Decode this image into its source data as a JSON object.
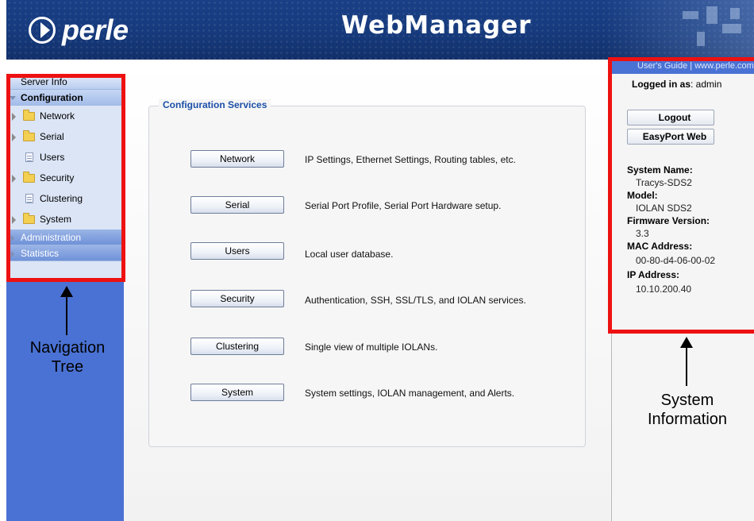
{
  "header": {
    "logo_text": "perle",
    "title": "WebManager"
  },
  "nav": {
    "server_info": "Server Info",
    "configuration": "Configuration",
    "items": [
      {
        "label": "Network",
        "kind": "folder"
      },
      {
        "label": "Serial",
        "kind": "folder"
      },
      {
        "label": "Users",
        "kind": "doc"
      },
      {
        "label": "Security",
        "kind": "folder"
      },
      {
        "label": "Clustering",
        "kind": "doc"
      },
      {
        "label": "System",
        "kind": "folder"
      }
    ],
    "administration": "Administration",
    "statistics": "Statistics"
  },
  "main": {
    "section_title": "Configuration Services",
    "services": [
      {
        "button": "Network",
        "desc": "IP Settings, Ethernet Settings, Routing tables, etc."
      },
      {
        "button": "Serial",
        "desc": "Serial Port Profile, Serial Port Hardware setup."
      },
      {
        "button": "Users",
        "desc": "Local user database."
      },
      {
        "button": "Security",
        "desc": "Authentication, SSH, SSL/TLS, and IOLAN services."
      },
      {
        "button": "Clustering",
        "desc": "Single view of multiple IOLANs."
      },
      {
        "button": "System",
        "desc": "System settings, IOLAN management, and Alerts."
      }
    ]
  },
  "right": {
    "links": "User's Guide | www.perle.com",
    "logged_label": "Logged in as",
    "logged_user": ": admin",
    "logout": "Logout",
    "easyport": "EasyPort Web",
    "system_name_label": "System Name:",
    "system_name": "Tracys-SDS2",
    "model_label": "Model:",
    "model": "IOLAN SDS2",
    "firmware_label": "Firmware Version:",
    "firmware": "3.3",
    "mac_label": "MAC Address:",
    "mac": "00-80-d4-06-00-02",
    "ip_label": "IP Address:",
    "ip": "10.10.200.40"
  },
  "annotations": {
    "nav_tree_line1": "Navigation",
    "nav_tree_line2": "Tree",
    "sys_info_line1": "System",
    "sys_info_line2": "Information"
  },
  "colors": {
    "header_blue": "#163a7c",
    "sidebar_blue": "#4a72d4",
    "annotation_red": "#ee1111",
    "legend_blue": "#1c4fa8"
  }
}
